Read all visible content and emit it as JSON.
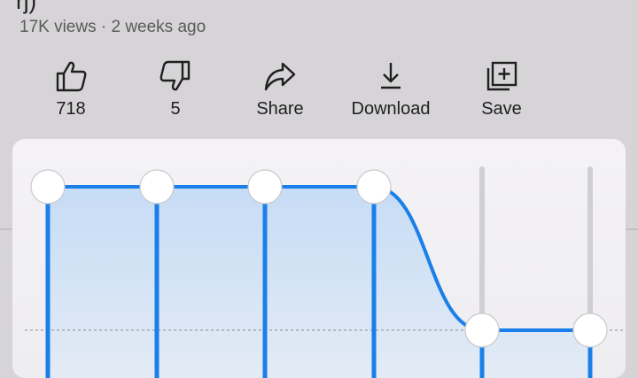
{
  "video": {
    "title_fragment": "ŋ)",
    "meta": "17K views · 2 weeks ago"
  },
  "actions": [
    {
      "name": "like-button",
      "icon": "thumbs-up-icon",
      "label": "718"
    },
    {
      "name": "dislike-button",
      "icon": "thumbs-down-icon",
      "label": "5"
    },
    {
      "name": "share-button",
      "icon": "share-icon",
      "label": "Share"
    },
    {
      "name": "download-button",
      "icon": "download-icon",
      "label": "Download"
    },
    {
      "name": "save-button",
      "icon": "save-playlist-icon",
      "label": "Save"
    }
  ],
  "equalizer": {
    "bands": [
      {
        "level": 1.0
      },
      {
        "level": 1.0
      },
      {
        "level": 1.0
      },
      {
        "level": 1.0
      },
      {
        "level": 0.0
      },
      {
        "level": 0.0
      }
    ],
    "colors": {
      "accent": "#1a7fe8",
      "fill_top": "#c6dcf5",
      "fill_bottom": "#e3ebf5",
      "track": "#cfcfd4",
      "handle": "#ffffff",
      "baseline": "#8d8d8d"
    }
  }
}
